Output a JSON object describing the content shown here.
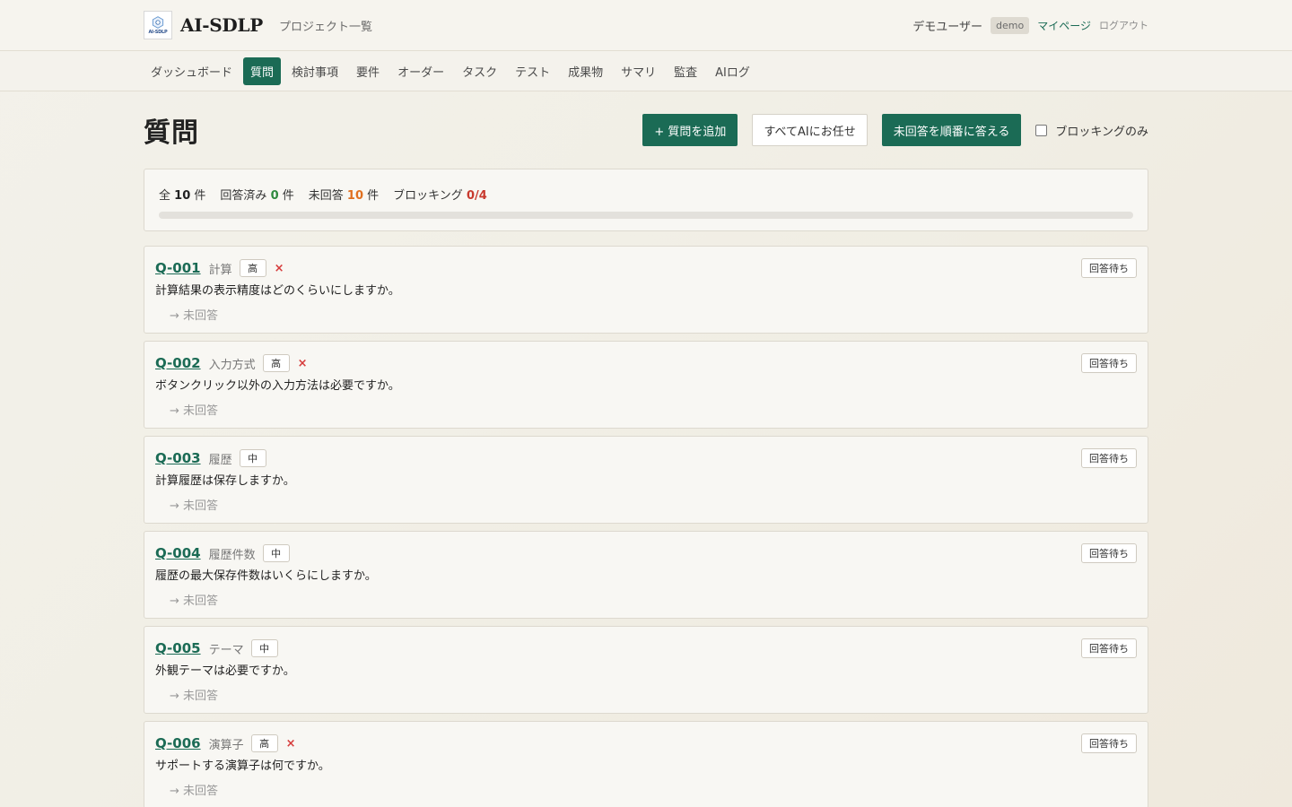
{
  "header": {
    "logo_text": "AI-SDLP",
    "app_name": "AI-SDLP",
    "project_link": "プロジェクト一覧",
    "user_name": "デモユーザー",
    "user_badge": "demo",
    "mypage": "マイページ",
    "logout": "ログアウト"
  },
  "nav": {
    "items": [
      {
        "label": "ダッシュボード",
        "active": false
      },
      {
        "label": "質問",
        "active": true
      },
      {
        "label": "検討事項",
        "active": false
      },
      {
        "label": "要件",
        "active": false
      },
      {
        "label": "オーダー",
        "active": false
      },
      {
        "label": "タスク",
        "active": false
      },
      {
        "label": "テスト",
        "active": false
      },
      {
        "label": "成果物",
        "active": false
      },
      {
        "label": "サマリ",
        "active": false
      },
      {
        "label": "監査",
        "active": false
      },
      {
        "label": "AIログ",
        "active": false
      }
    ]
  },
  "page": {
    "title": "質問",
    "add_button": "+ 質問を追加",
    "ai_button": "すべてAIにお任せ",
    "answer_button": "未回答を順番に答える",
    "blocking_filter": "ブロッキングのみ",
    "blocking_filter_checked": false
  },
  "summary": {
    "total_prefix": "全",
    "total": "10",
    "total_suffix": "件",
    "answered_prefix": "回答済み",
    "answered": "0",
    "answered_suffix": "件",
    "unanswered_prefix": "未回答",
    "unanswered": "10",
    "unanswered_suffix": "件",
    "blocking_prefix": "ブロッキング",
    "blocking": "0/4",
    "progress": 0
  },
  "questions": [
    {
      "id": "Q-001",
      "category": "計算",
      "priority": "高",
      "blocking": true,
      "blocking_icon": "×",
      "text": "計算結果の表示精度はどのくらいにしますか。",
      "answer": "→ 未回答",
      "status": "回答待ち"
    },
    {
      "id": "Q-002",
      "category": "入力方式",
      "priority": "高",
      "blocking": true,
      "blocking_icon": "×",
      "text": "ボタンクリック以外の入力方法は必要ですか。",
      "answer": "→ 未回答",
      "status": "回答待ち"
    },
    {
      "id": "Q-003",
      "category": "履歴",
      "priority": "中",
      "blocking": false,
      "blocking_icon": "",
      "text": "計算履歴は保存しますか。",
      "answer": "→ 未回答",
      "status": "回答待ち"
    },
    {
      "id": "Q-004",
      "category": "履歴件数",
      "priority": "中",
      "blocking": false,
      "blocking_icon": "",
      "text": "履歴の最大保存件数はいくらにしますか。",
      "answer": "→ 未回答",
      "status": "回答待ち"
    },
    {
      "id": "Q-005",
      "category": "テーマ",
      "priority": "中",
      "blocking": false,
      "blocking_icon": "",
      "text": "外観テーマは必要ですか。",
      "answer": "→ 未回答",
      "status": "回答待ち"
    },
    {
      "id": "Q-006",
      "category": "演算子",
      "priority": "高",
      "blocking": true,
      "blocking_icon": "×",
      "text": "サポートする演算子は何ですか。",
      "answer": "→ 未回答",
      "status": "回答待ち"
    }
  ]
}
